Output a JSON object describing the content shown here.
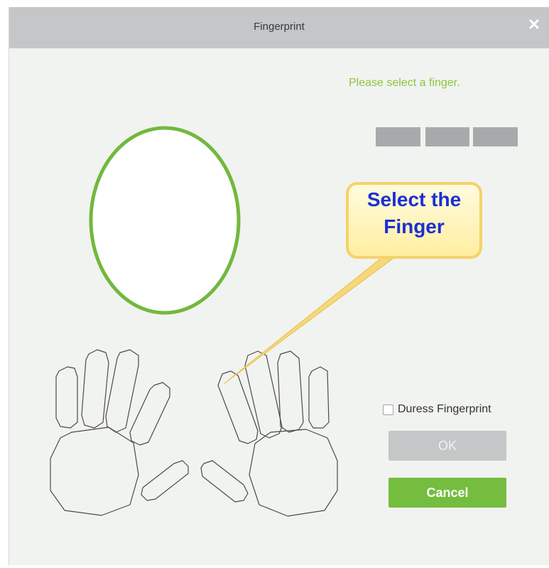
{
  "dialog": {
    "title": "Fingerprint",
    "close_icon": "close-icon",
    "prompt": "Please select a finger.",
    "progress": {
      "segments": 3,
      "completed": 0,
      "segment_color": "#a7a9ab"
    },
    "preview": {
      "border_color": "#72b83d",
      "fill_color": "#ffffff"
    },
    "callout": {
      "text_line1": "Select the",
      "text_line2": "Finger",
      "fill_color": "#fff6c0",
      "border_color": "#f5d26a",
      "text_color": "#1a2fd6"
    },
    "duress_label": "Duress Fingerprint",
    "duress_checked": false,
    "ok_label": "OK",
    "cancel_label": "Cancel",
    "accent_color": "#74bd3f",
    "prompt_color": "#8cc63f"
  }
}
